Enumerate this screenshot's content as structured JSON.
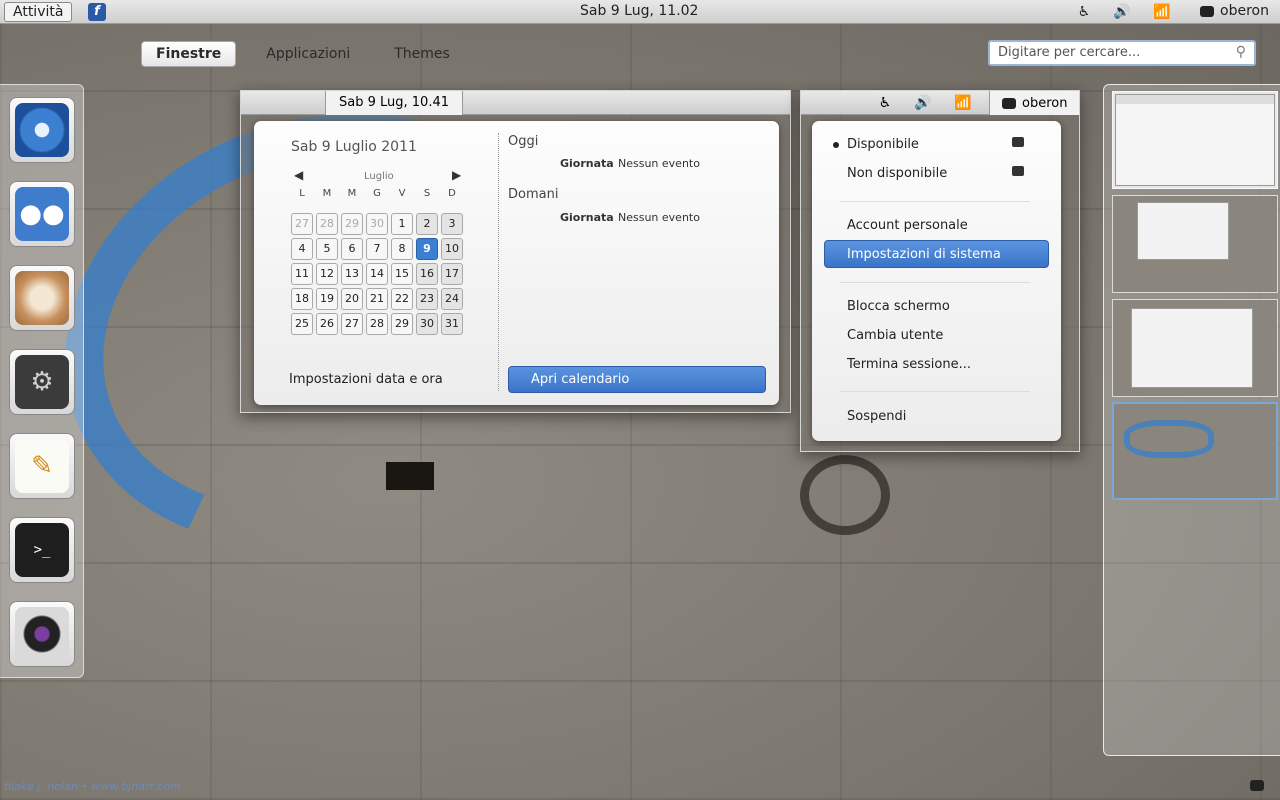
{
  "topbar": {
    "activities": "Attività",
    "clock": "Sab  9 Lug, 11.02",
    "user": "oberon",
    "tray": [
      "accessibility-icon",
      "volume-icon",
      "wifi-icon"
    ]
  },
  "overview": {
    "tabs": [
      "Finestre",
      "Applicazioni",
      "Themes"
    ],
    "search_placeholder": "Digitare per cercare..."
  },
  "dock": [
    "chromium-icon",
    "empathy-icon",
    "nautilus-icon",
    "settings-icon",
    "gedit-icon",
    "terminal-icon",
    "cheese-icon"
  ],
  "calendar_window": {
    "clock": "Sab  9 Lug, 10.41",
    "title": "Sab  9 Luglio 2011",
    "month": "Luglio",
    "weekdays": [
      "L",
      "M",
      "M",
      "G",
      "V",
      "S",
      "D"
    ],
    "weeks": [
      [
        "27",
        "28",
        "29",
        "30",
        "1",
        "2",
        "3"
      ],
      [
        "4",
        "5",
        "6",
        "7",
        "8",
        "9",
        "10"
      ],
      [
        "11",
        "12",
        "13",
        "14",
        "15",
        "16",
        "17"
      ],
      [
        "18",
        "19",
        "20",
        "21",
        "22",
        "23",
        "24"
      ],
      [
        "25",
        "26",
        "27",
        "28",
        "29",
        "30",
        "31"
      ]
    ],
    "today": "Oggi",
    "tomorrow": "Domani",
    "event_label": "Giornata",
    "event_text": "Nessun evento",
    "settings_link": "Impostazioni data e ora",
    "open_calendar": "Apri calendario"
  },
  "user_window": {
    "user": "oberon",
    "items": [
      "Disponibile",
      "Non disponibile",
      "Account personale",
      "Impostazioni di sistema",
      "Blocca schermo",
      "Cambia utente",
      "Termina sessione...",
      "Sospendi"
    ]
  },
  "watermark": "blake j. nolan • www.bjnart.com",
  "colors": {
    "accent": "#3b7fd3",
    "graffiti": "#3a7fc8"
  }
}
